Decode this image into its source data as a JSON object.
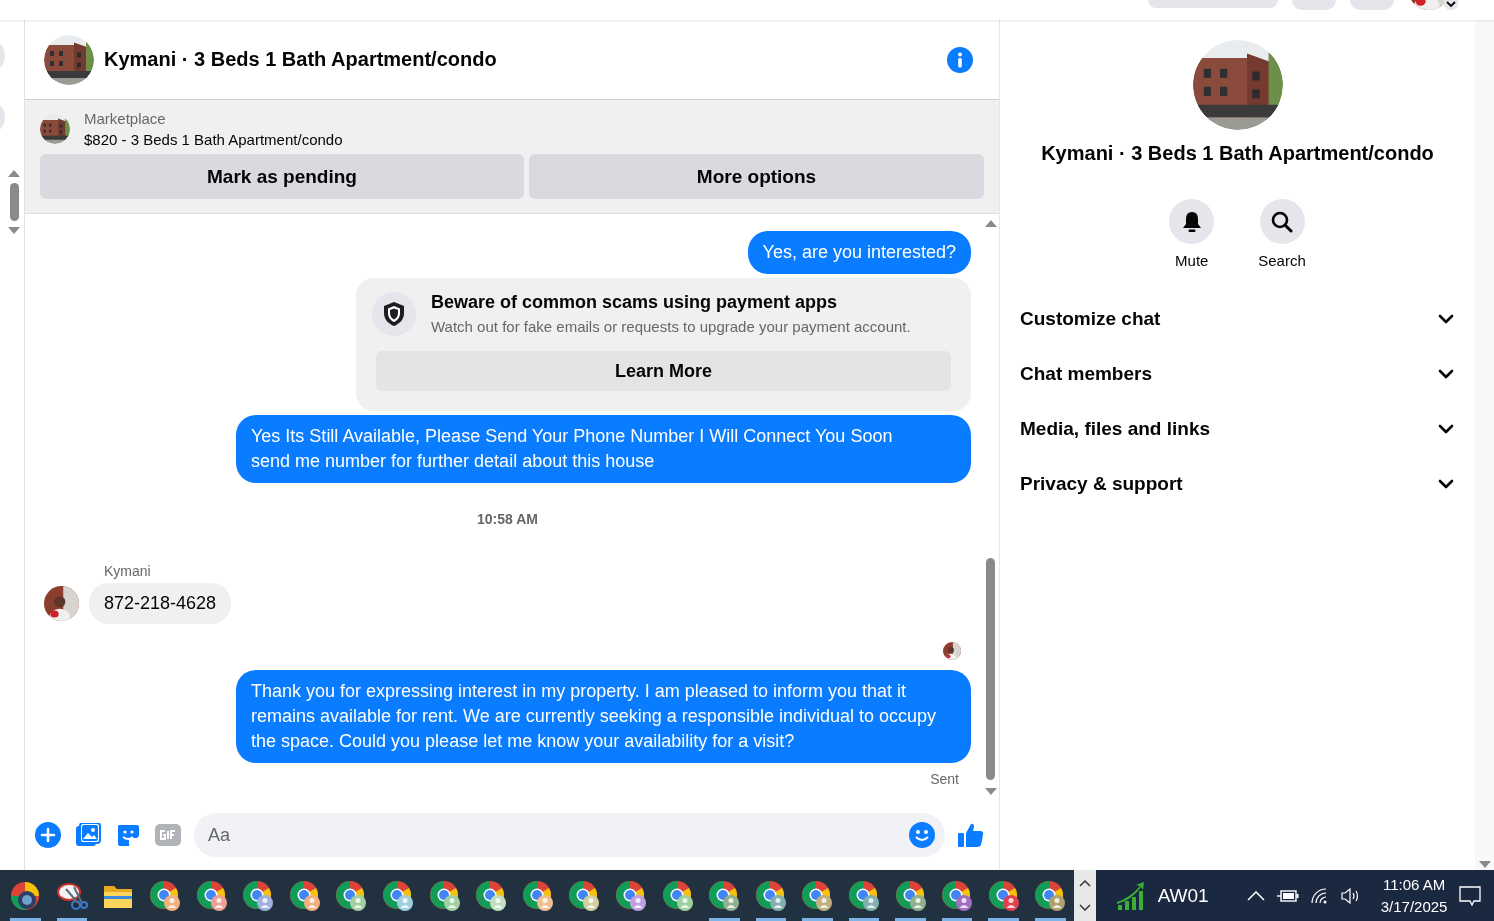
{
  "header": {
    "title": "Kymani · 3 Beds 1 Bath Apartment/condo"
  },
  "listing": {
    "source": "Marketplace",
    "summary": "$820 - 3 Beds 1 Bath Apartment/condo",
    "buttons": [
      "Mark as pending",
      "More options"
    ]
  },
  "messages": [
    {
      "kind": "outgoing",
      "text": "Yes, are you interested?"
    },
    {
      "kind": "notice",
      "title": "Beware of common scams using payment apps",
      "body": "Watch out for fake emails or requests to upgrade your payment account.",
      "button": "Learn More"
    },
    {
      "kind": "outgoing",
      "text": "Yes Its Still Available, Please Send Your Phone Number I Will Connect You Soon\nsend me number for further detail about this house"
    },
    {
      "kind": "timestamp",
      "text": "10:58 AM"
    },
    {
      "kind": "incoming",
      "sender": "Kymani",
      "text": "872-218-4628"
    },
    {
      "kind": "seen"
    },
    {
      "kind": "outgoing",
      "text": "Thank you for expressing interest in my property. I am pleased to inform you that it remains available for rent. We are currently seeking a responsible individual to occupy the space. Could you please let me know your availability for a visit?"
    },
    {
      "kind": "status",
      "text": "Sent"
    }
  ],
  "composer": {
    "placeholder": "Aa"
  },
  "details": {
    "title": "Kymani · 3 Beds 1 Bath Apartment/condo",
    "actions": [
      {
        "kind": "mute",
        "label": "Mute"
      },
      {
        "kind": "search",
        "label": "Search"
      }
    ],
    "sections": [
      {
        "label": "Customize chat",
        "expanded": false
      },
      {
        "label": "Chat members",
        "expanded": false
      },
      {
        "label": "Media, files and links",
        "expanded": false
      },
      {
        "label": "Privacy & support",
        "expanded": false
      }
    ]
  },
  "taskbar": {
    "apps": [
      {
        "kind": "globe",
        "running": true
      },
      {
        "kind": "snip",
        "running": true
      },
      {
        "kind": "folder",
        "running": false
      },
      {
        "kind": "chrome",
        "running": false,
        "color": "#f0b080"
      },
      {
        "kind": "chrome",
        "running": false,
        "color": "#f0a090"
      },
      {
        "kind": "chrome",
        "running": false,
        "color": "#a0b0e0"
      },
      {
        "kind": "chrome",
        "running": false,
        "color": "#f0b080"
      },
      {
        "kind": "chrome",
        "running": false,
        "color": "#a0d0a0"
      },
      {
        "kind": "chrome",
        "running": false,
        "color": "#a0d0e0"
      },
      {
        "kind": "chrome",
        "running": false,
        "color": "#a0d0a0"
      },
      {
        "kind": "chrome",
        "running": false,
        "color": "#c0e0c0"
      },
      {
        "kind": "chrome",
        "running": false,
        "color": "#f0c090"
      },
      {
        "kind": "chrome",
        "running": false,
        "color": "#d0d0a0"
      },
      {
        "kind": "chrome",
        "running": false,
        "color": "#c0a0e0"
      },
      {
        "kind": "chrome",
        "running": false,
        "color": "#a0d0a0"
      },
      {
        "kind": "chrome",
        "running": true,
        "color": "#90b090"
      },
      {
        "kind": "chrome",
        "running": true,
        "color": "#80b0b0"
      },
      {
        "kind": "chrome",
        "running": true,
        "color": "#c0b080"
      },
      {
        "kind": "chrome",
        "running": true,
        "color": "#80b0b0"
      },
      {
        "kind": "chrome",
        "running": true,
        "color": "#90b090"
      },
      {
        "kind": "chrome",
        "running": true,
        "color": "#a070c0"
      },
      {
        "kind": "chrome",
        "running": true,
        "color": "#e04050"
      },
      {
        "kind": "chrome",
        "running": true,
        "color": "#b0a070"
      }
    ],
    "tray_app": "AW01",
    "time": "11:06 AM",
    "date": "3/17/2025"
  }
}
